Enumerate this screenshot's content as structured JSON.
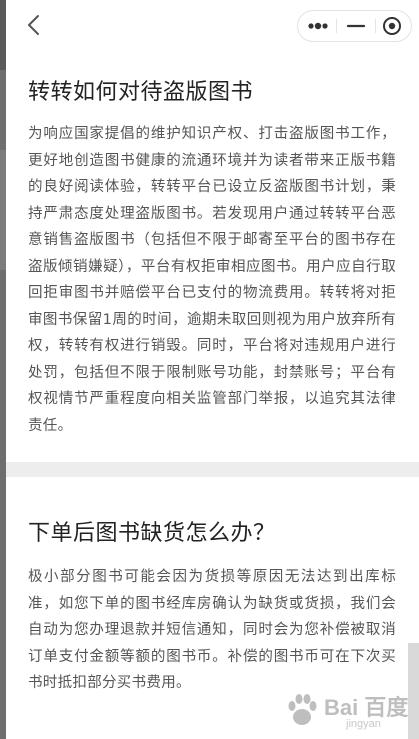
{
  "faq": [
    {
      "title": "转转如何对待盗版图书",
      "body": "为响应国家提倡的维护知识产权、打击盗版图书工作，更好地创造图书健康的流通环境并为读者带来正版书籍的良好阅读体验，转转平台已设立反盗版图书计划，秉持严肃态度处理盗版图书。若发现用户通过转转平台恶意销售盗版图书（包括但不限于邮寄至平台的图书存在盗版倾销嫌疑），平台有权拒审相应图书。用户应自行取回拒审图书并赔偿平台已支付的物流费用。转转将对拒审图书保留1周的时间，逾期未取回则视为用户放弃所有权，转转有权进行销毁。同时，平台将对违规用户进行处罚，包括但不限于限制账号功能，封禁账号；平台有权视情节严重程度向相关监管部门举报，以追究其法律责任。"
    },
    {
      "title": "下单后图书缺货怎么办？",
      "body": "极小部分图书可能会因为货损等原因无法达到出库标准，如您下单的图书经库房确认为缺货或货损，我们会自动为您办理退款并短信通知，同时会为您补偿被取消订单支付金额等额的图书币。补偿的图书币可在下次买书时抵扣部分买书费用。"
    }
  ],
  "icons": {
    "back": "chevron-left-icon",
    "more": "more-dots-icon",
    "minimize": "minimize-icon",
    "close": "target-close-icon"
  },
  "watermark": {
    "text": "Bai 百度",
    "sub": "jingyan"
  },
  "colors": {
    "title": "#222222",
    "body": "#555555",
    "divider": "#ededed",
    "background": "#ffffff"
  }
}
